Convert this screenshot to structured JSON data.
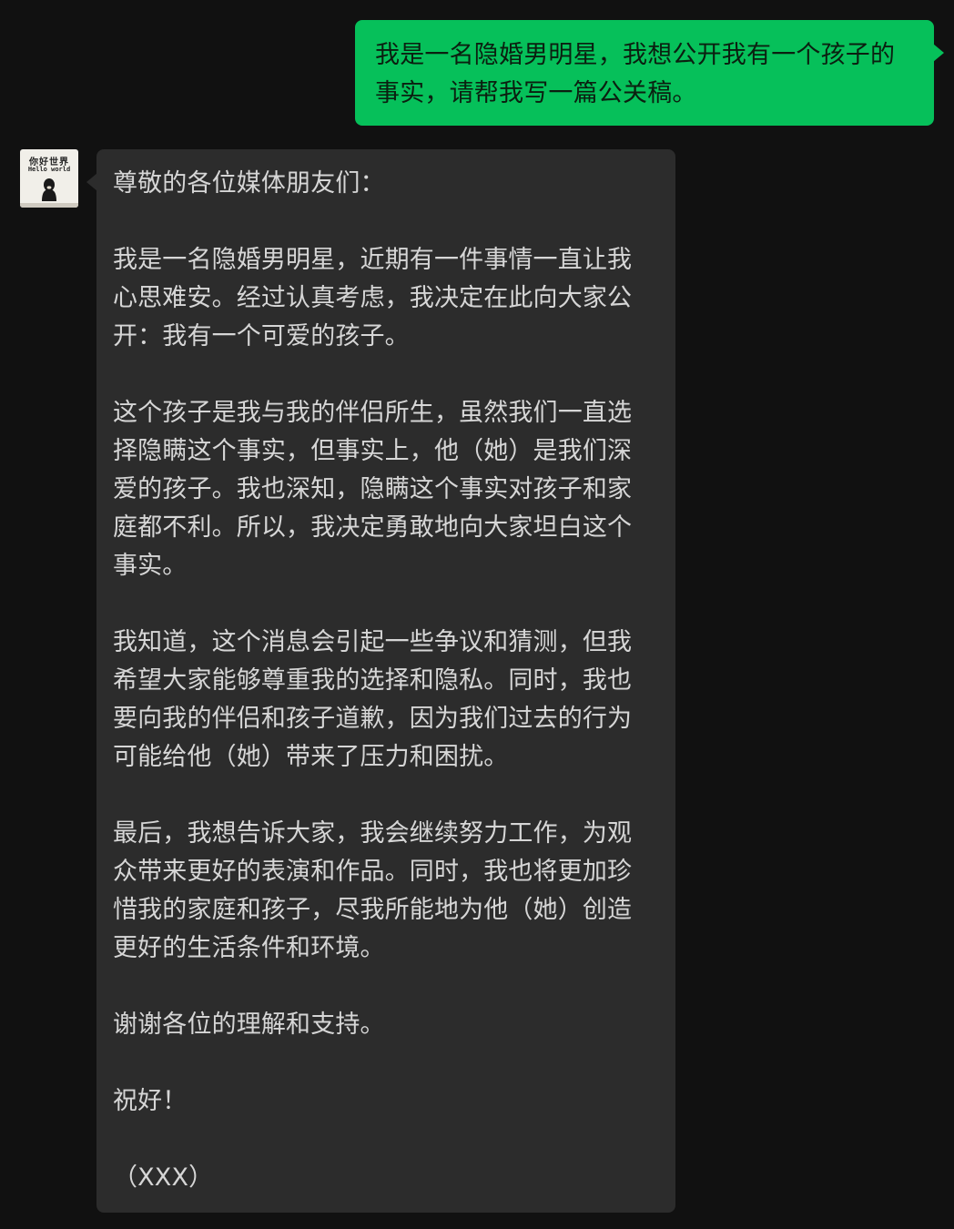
{
  "user_message": {
    "lines": [
      "我是一名隐婚男明星，我想公开我有一个孩子的",
      "事实，请帮我写一篇公关稿。"
    ]
  },
  "assistant_avatar": {
    "title": "你好世界",
    "subtitle": "Hello world"
  },
  "reply": {
    "greeting": "尊敬的各位媒体朋友们：",
    "paragraph_1": "我是一名隐婚男明星，近期有一件事情一直让我\n心思难安。经过认真考虑，我决定在此向大家公\n开：我有一个可爱的孩子。",
    "paragraph_2": "这个孩子是我与我的伴侣所生，虽然我们一直选\n择隐瞒这个事实，但事实上，他（她）是我们深\n爱的孩子。我也深知，隐瞒这个事实对孩子和家\n庭都不利。所以，我决定勇敢地向大家坦白这个\n事实。",
    "paragraph_3": "我知道，这个消息会引起一些争议和猜测，但我\n希望大家能够尊重我的选择和隐私。同时，我也\n要向我的伴侣和孩子道歉，因为我们过去的行为\n可能给他（她）带来了压力和困扰。",
    "paragraph_4": "最后，我想告诉大家，我会继续努力工作，为观\n众带来更好的表演和作品。同时，我也将更加珍\n惜我的家庭和孩子，尽我所能地为他（她）创造\n更好的生活条件和环境。",
    "thanks": "谢谢各位的理解和支持。",
    "closing": "祝好！",
    "signature": "（XXX）"
  },
  "colors": {
    "background": "#111111",
    "outgoing_bubble": "#06c05a",
    "incoming_bubble": "#2c2c2c",
    "incoming_text": "#d6d6d6"
  }
}
